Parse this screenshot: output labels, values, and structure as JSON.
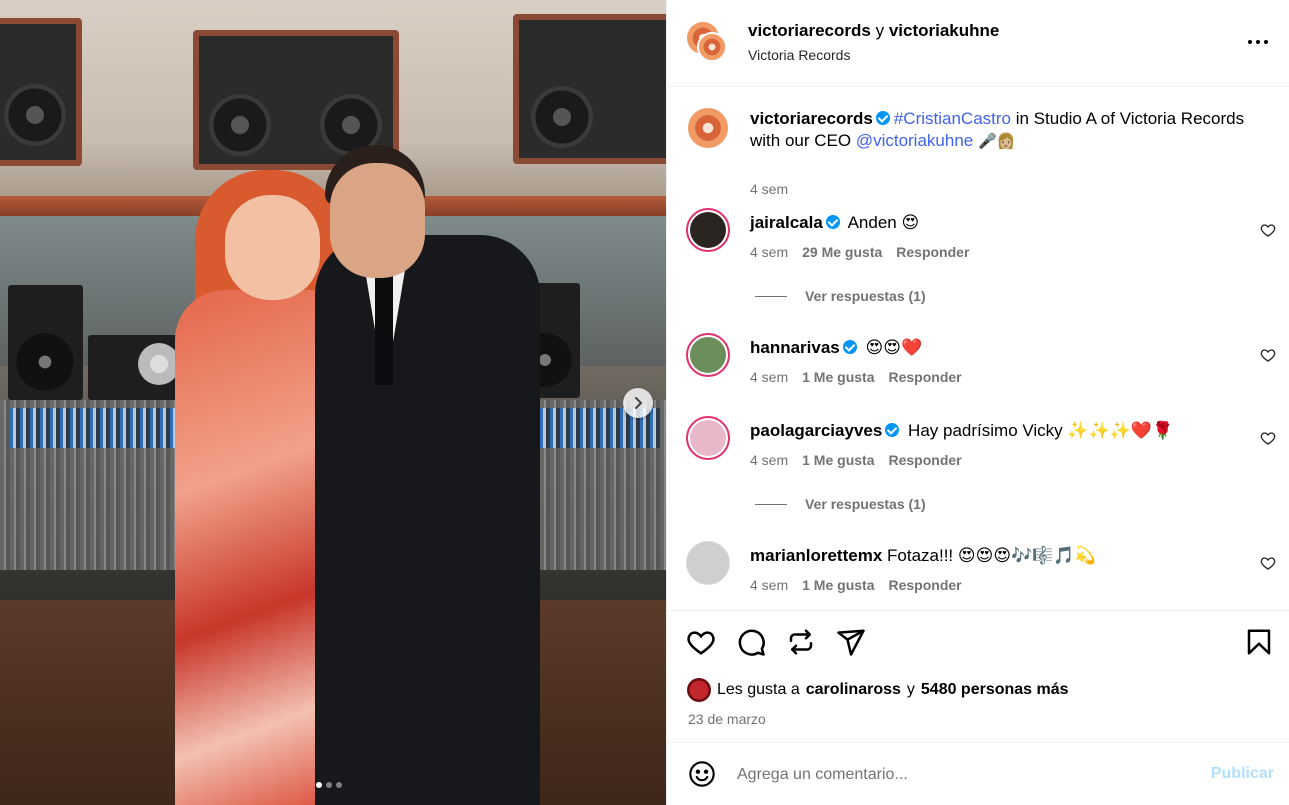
{
  "post": {
    "owner": "victoriarecords",
    "conjunction": "y",
    "collaborator": "victoriakuhne",
    "subtitle": "Victoria Records",
    "more_icon": "more-horizontal-icon"
  },
  "caption": {
    "user": "victoriarecords",
    "hashtag": "#CristianCastro",
    "text_mid": " in Studio A of Victoria Records with our CEO ",
    "mention": "@victoriakuhne",
    "emojis": "🎤👩🏼",
    "time": "4 sem"
  },
  "comments": [
    {
      "user": "jairalcala",
      "text": "Anden 😍",
      "time": "4 sem",
      "likes": "29 Me gusta",
      "reply": "Responder",
      "replies": "Ver respuestas (1)",
      "avatar_color": "#2a2520"
    },
    {
      "user": "hannarivas",
      "text": "😍😍❤️",
      "time": "4 sem",
      "likes": "1 Me gusta",
      "reply": "Responder",
      "avatar_color": "#6b8e5a"
    },
    {
      "user": "paolagarciayves",
      "text": "Hay padrísimo Vicky ✨✨✨❤️🌹",
      "time": "4 sem",
      "likes": "1 Me gusta",
      "reply": "Responder",
      "replies": "Ver respuestas (1)",
      "avatar_color": "#e8b7c9"
    },
    {
      "user": "marianlorettemx",
      "text": "Fotaza!!! 😍😍😍🎶🎼🎵💫",
      "time": "4 sem",
      "likes": "1 Me gusta",
      "reply": "Responder",
      "avatar_color": "#cfcfcf"
    }
  ],
  "actions": {
    "icons": [
      "heart-icon",
      "comment-icon",
      "repost-icon",
      "share-icon",
      "bookmark-icon"
    ]
  },
  "likes": {
    "prefix": "Les gusta a",
    "user": "carolinaross",
    "conj": "y",
    "rest": "5480 personas más"
  },
  "date": "23 de marzo",
  "composer": {
    "placeholder": "Agrega un comentario...",
    "publish": "Publicar"
  },
  "carousel": {
    "total": 3,
    "active": 1
  },
  "colors": {
    "link": "#4263eb",
    "verified": "#0095f6",
    "meta": "#737373",
    "publish_disabled": "#b2dffc"
  }
}
